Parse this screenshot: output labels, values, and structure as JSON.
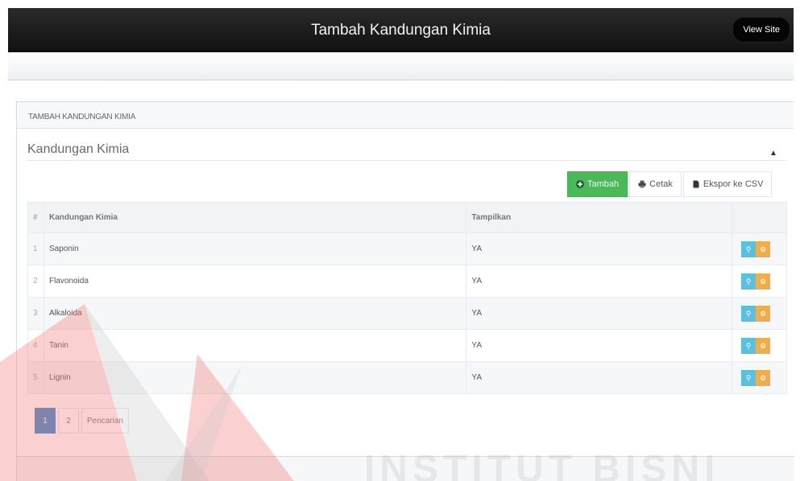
{
  "header": {
    "title": "Tambah Kandungan Kimia",
    "view_site_label": "View Site"
  },
  "panel": {
    "heading": "TAMBAH KANDUNGAN KIMIA",
    "widget_title": "Kandungan Kimia"
  },
  "toolbar": {
    "add_label": "Tambah",
    "print_label": "Cetak",
    "export_label": "Ekspor ke CSV"
  },
  "table": {
    "headers": [
      "#",
      "Kandungan Kimia",
      "Tampilkan",
      ""
    ],
    "rows": [
      {
        "no": "1",
        "name": "Saponin",
        "show": "YA"
      },
      {
        "no": "2",
        "name": "Flavonoida",
        "show": "YA"
      },
      {
        "no": "3",
        "name": "Alkaloida",
        "show": "YA"
      },
      {
        "no": "4",
        "name": "Tanin",
        "show": "YA"
      },
      {
        "no": "5",
        "name": "Lignin",
        "show": "YA"
      }
    ]
  },
  "pagination": {
    "pages": [
      "1",
      "2"
    ],
    "active": "1",
    "search_label": "Pencarian"
  },
  "watermark": {
    "text": "INSTITUT BISNI"
  },
  "colors": {
    "add_button": "#4cb85c",
    "view_button": "#5bc0de",
    "edit_button": "#f0ad4e",
    "active_page": "#428bca",
    "watermark": "#f4b3b3"
  },
  "icons": {
    "add": "plus-circle-icon",
    "print": "printer-icon",
    "export": "file-icon",
    "collapse": "chevron-up-icon",
    "view": "search-icon",
    "edit": "gear-icon"
  }
}
